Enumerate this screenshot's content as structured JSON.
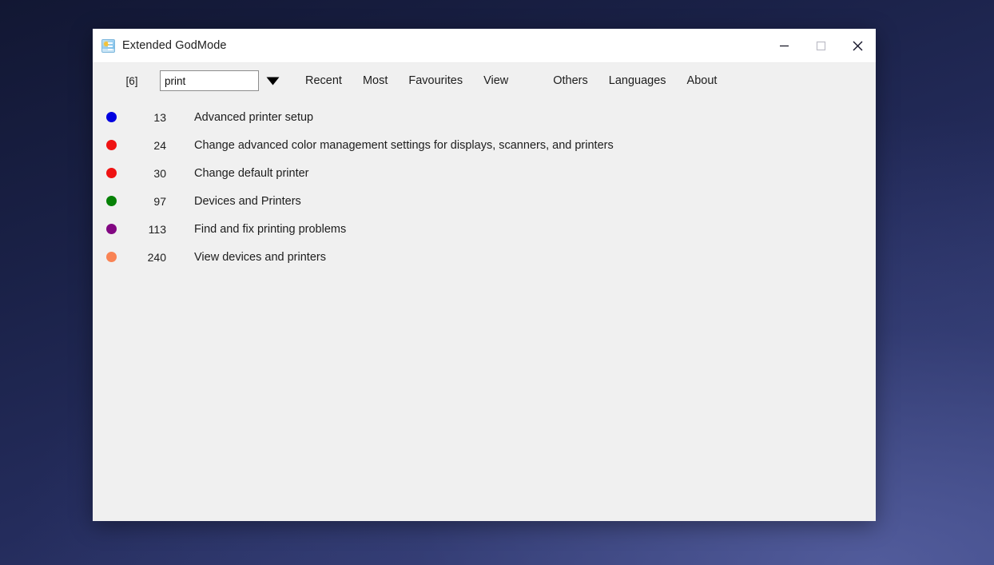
{
  "window": {
    "title": "Extended GodMode",
    "icon": "picture-icon",
    "controls": {
      "minimize": "minimize-icon",
      "maximize": "maximize-icon",
      "close": "close-icon"
    }
  },
  "toolbar": {
    "count_badge": "[6]",
    "search": {
      "value": "print",
      "placeholder": ""
    },
    "dropdown_icon": "chevron-down-icon",
    "menu_left": [
      {
        "label": "Recent",
        "name": "recent"
      },
      {
        "label": "Most",
        "name": "most"
      },
      {
        "label": "Favourites",
        "name": "favourites"
      },
      {
        "label": "View",
        "name": "view"
      }
    ],
    "menu_right": [
      {
        "label": "Others",
        "name": "others"
      },
      {
        "label": "Languages",
        "name": "languages"
      },
      {
        "label": "About",
        "name": "about"
      }
    ]
  },
  "list": {
    "rows": [
      {
        "number": "13",
        "label": "Advanced printer setup",
        "color": "#0000e0"
      },
      {
        "number": "24",
        "label": "Change advanced color management settings for displays, scanners, and printers",
        "color": "#ef1313"
      },
      {
        "number": "30",
        "label": "Change default printer",
        "color": "#ef1313"
      },
      {
        "number": "97",
        "label": "Devices and Printers",
        "color": "#068106"
      },
      {
        "number": "113",
        "label": "Find and fix printing problems",
        "color": "#820782"
      },
      {
        "number": "240",
        "label": "View devices and printers",
        "color": "#f98354"
      }
    ]
  },
  "colors": {
    "window_body": "#f0f0f0",
    "titlebar": "#ffffff",
    "text": "#1d1d1d",
    "desktop_top": "#121733",
    "desktop_bottom": "#3b4584"
  }
}
